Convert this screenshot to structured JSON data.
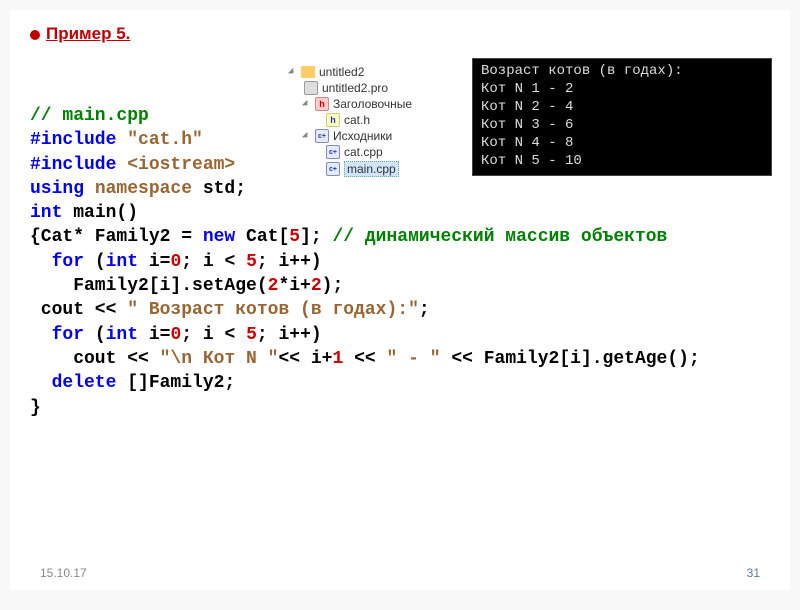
{
  "title": "Пример 5.",
  "code": {
    "l1": "// main.cpp",
    "l2a": "#include ",
    "l2b": "\"cat.h\"",
    "l3a": "#include ",
    "l3b": "<iostream>",
    "l4a": "using ",
    "l4b": "namespace",
    "l4c": " std;",
    "l5a": "int ",
    "l5b": "main()",
    "l6a": "{Cat* Family2 = ",
    "l6b": "new",
    "l6c": " Cat[",
    "l6d": "5",
    "l6e": "]; ",
    "l6f": "// динамический массив объектов",
    "l7a": "  for ",
    "l7b": "(",
    "l7c": "int",
    "l7d": " i=",
    "l7e": "0",
    "l7f": "; i < ",
    "l7g": "5",
    "l7h": "; i++)",
    "l8a": "    Family2[i].setAge(",
    "l8b": "2",
    "l8c": "*i+",
    "l8d": "2",
    "l8e": ");",
    "l9a": " cout << ",
    "l9b": "\" Возраст котов (в годах):\"",
    "l9c": ";",
    "l10a": "  for ",
    "l10b": "(",
    "l10c": "int",
    "l10d": " i=",
    "l10e": "0",
    "l10f": "; i < ",
    "l10g": "5",
    "l10h": "; i++)",
    "l11a": "    cout << ",
    "l11b": "\"\\n Кот N \"",
    "l11c": "<< i+",
    "l11d": "1",
    "l11e": " << ",
    "l11f": "\" - \"",
    "l11g": " << Family2[i].getAge();",
    "l12a": "  delete ",
    "l12b": "[]Family2;",
    "l13": "}"
  },
  "tree": {
    "root": "untitled2",
    "pro": "untitled2.pro",
    "headers": "Заголовочные",
    "cath": "cat.h",
    "sources": "Исходники",
    "catcpp": "cat.cpp",
    "maincpp": "main.cpp"
  },
  "terminal": "Возраст котов (в годах):\nКот N 1 - 2\nКот N 2 - 4\nКот N 3 - 6\nКот N 4 - 8\nКот N 5 - 10",
  "footer": {
    "date": "15.10.17",
    "page": "31"
  }
}
